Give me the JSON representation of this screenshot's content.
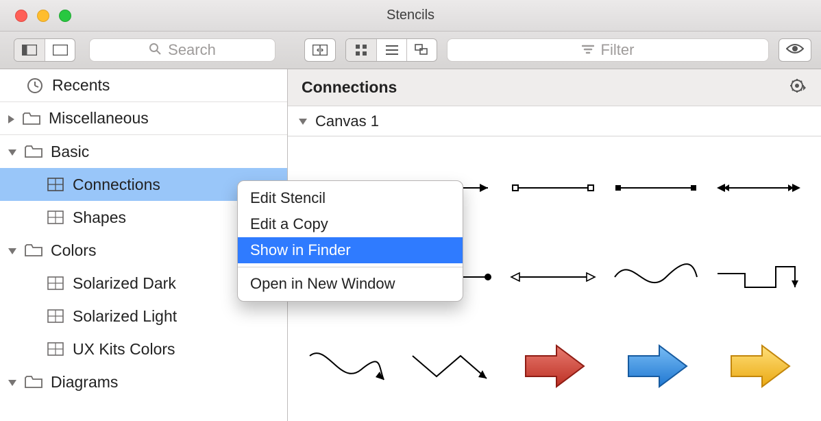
{
  "window": {
    "title": "Stencils"
  },
  "toolbar": {
    "search_placeholder": "Search",
    "filter_placeholder": "Filter"
  },
  "sidebar": {
    "recents_label": "Recents",
    "groups": [
      {
        "label": "Miscellaneous",
        "expanded": false,
        "children": []
      },
      {
        "label": "Basic",
        "expanded": true,
        "children": [
          {
            "label": "Connections",
            "selected": true
          },
          {
            "label": "Shapes",
            "selected": false
          }
        ]
      },
      {
        "label": "Colors",
        "expanded": true,
        "children": [
          {
            "label": "Solarized Dark",
            "selected": false
          },
          {
            "label": "Solarized Light",
            "selected": false
          },
          {
            "label": "UX Kits Colors",
            "selected": false
          }
        ]
      },
      {
        "label": "Diagrams",
        "expanded": true,
        "children": []
      }
    ]
  },
  "main": {
    "title": "Connections",
    "canvas_label": "Canvas 1"
  },
  "context_menu": {
    "items": [
      {
        "label": "Edit Stencil",
        "selected": false
      },
      {
        "label": "Edit a Copy",
        "selected": false
      },
      {
        "label": "Show in Finder",
        "selected": true
      },
      {
        "separator": true
      },
      {
        "label": "Open in New Window",
        "selected": false
      }
    ]
  },
  "colors": {
    "selection_row": "#99c6f9",
    "menu_highlight": "#2f7bff",
    "arrow_red": "#d44a3e",
    "arrow_blue": "#3a98eb",
    "arrow_yellow": "#f7c32f"
  }
}
